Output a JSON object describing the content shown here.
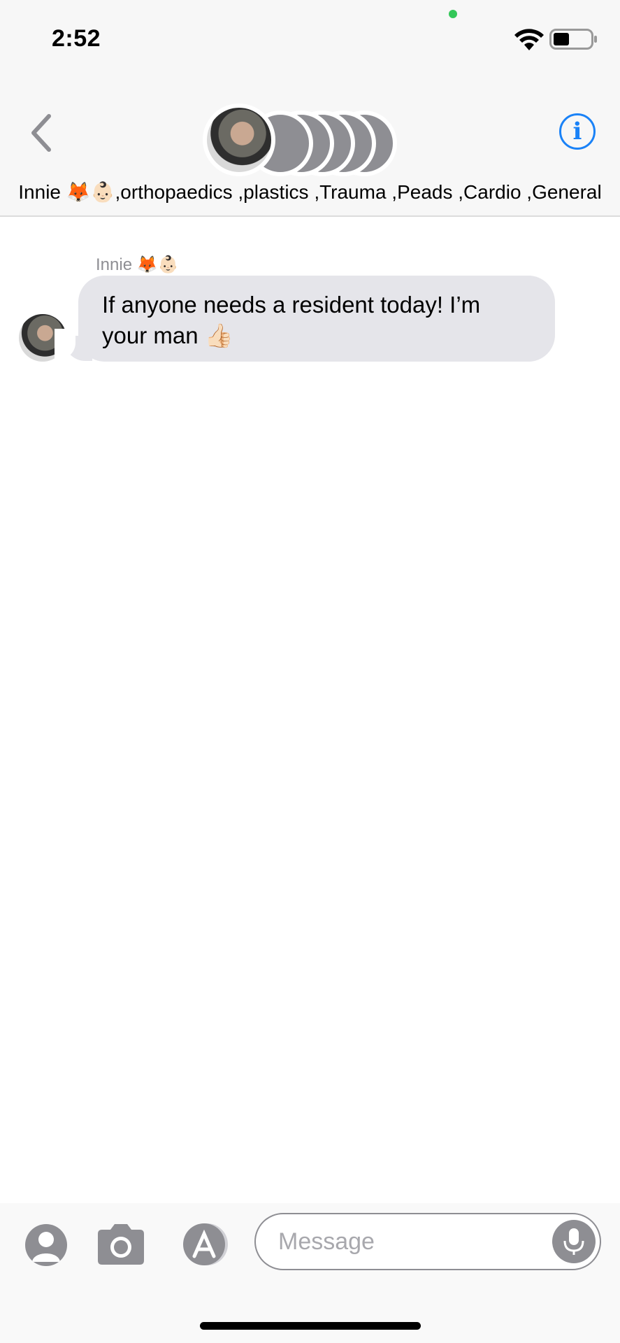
{
  "status_bar": {
    "time": "2:52",
    "camera_indicator_color": "#34c759",
    "icons": [
      "wifi-icon",
      "battery-icon"
    ]
  },
  "header": {
    "back_icon": "chevron-left-icon",
    "info_icon": "info-icon",
    "info_label": "i",
    "group_name": "Innie 🦊👶🏻,orthopaedics ,plastics ,Trauma ,Peads ,Cardio ,General",
    "accent_color": "#1a82f7"
  },
  "messages": [
    {
      "sender": "Innie 🦊👶🏻",
      "text": "If anyone needs a resident today! I’m your man 👍🏻",
      "bubble_color": "#e5e5ea"
    }
  ],
  "composer": {
    "placeholder": "Message",
    "icons": [
      "contact-icon",
      "camera-icon",
      "app-store-icon",
      "microphone-icon"
    ]
  }
}
